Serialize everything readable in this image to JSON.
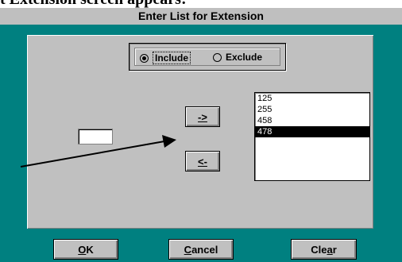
{
  "doc": {
    "text": "t Extension screen appears:"
  },
  "dialog": {
    "title": "Enter List for Extension",
    "radio": {
      "include_label": "Include",
      "exclude_label": "Exclude",
      "selected": "Include"
    },
    "input_value": "",
    "move_right_label": "->",
    "move_left_label": "<-",
    "list_items": [
      "125",
      "255",
      "458",
      "478"
    ],
    "selected_item": "478",
    "buttons": {
      "ok": {
        "pre": "",
        "key": "O",
        "post": "K"
      },
      "cancel": {
        "pre": "",
        "key": "C",
        "post": "ancel"
      },
      "clear": {
        "pre": "Cle",
        "key": "a",
        "post": "r"
      }
    }
  },
  "colors": {
    "desktop": "#008080",
    "face": "#c0c0c0",
    "title": "#bfbfbf"
  }
}
